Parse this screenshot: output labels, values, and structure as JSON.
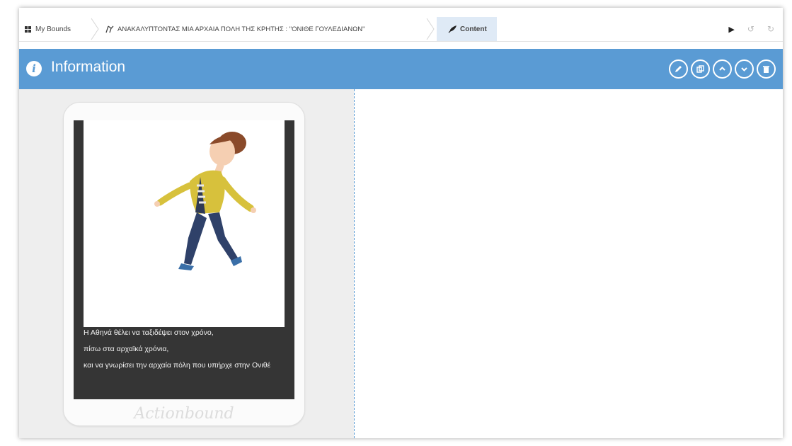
{
  "breadcrumb": {
    "home_label": "My Bounds",
    "bound_title": "ΑΝΑΚΑΛΥΠΤΟΝΤΑΣ ΜΙΑ ΑΡΧΑΙΑ ΠΟΛΗ ΤΗΣ ΚΡΗΤΗΣ : \"ΟΝΙΘΕ ΓΟΥΛΕΔΙΑΝΩΝ\"",
    "current_label": "Content"
  },
  "toolbar": {
    "play_icon": "play-icon",
    "undo_icon": "undo-icon",
    "redo_icon": "redo-icon"
  },
  "section": {
    "title": "Information",
    "icon": "info-icon",
    "buttons": [
      "edit-icon",
      "duplicate-icon",
      "move-up-icon",
      "move-down-icon",
      "delete-icon"
    ]
  },
  "preview": {
    "caption_lines": [
      "Η Αθηνά θέλει να ταξιδέψει στον χρόνο,",
      "πίσω στα αρχαϊκά χρόνια,",
      "και να γνωρίσει την αρχαία πόλη που υπήρχε στην Ονιθέ"
    ],
    "brand": "Actionbound"
  },
  "colors": {
    "accent": "#5a9bd4",
    "active_crumb": "#dfeaf6",
    "screen_bg": "#353535"
  }
}
